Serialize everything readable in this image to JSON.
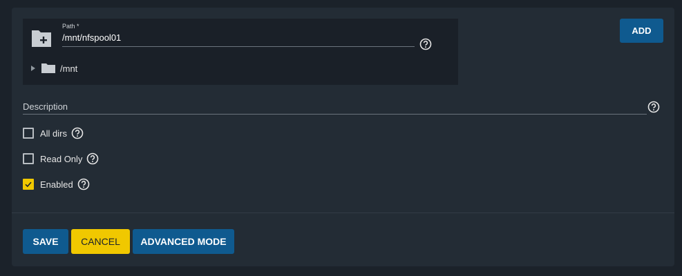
{
  "path_field": {
    "label": "Path *",
    "value": "/mnt/nfspool01",
    "tree_root": "/mnt"
  },
  "add_button": "ADD",
  "description": {
    "label": "Description"
  },
  "checkboxes": [
    {
      "label": "All dirs",
      "checked": false
    },
    {
      "label": "Read Only",
      "checked": false
    },
    {
      "label": "Enabled",
      "checked": true
    }
  ],
  "actions": {
    "save": "SAVE",
    "cancel": "CANCEL",
    "advanced": "ADVANCED MODE"
  },
  "colors": {
    "primary": "#0f5a8f",
    "accent": "#f0c800",
    "background": "#1b222a",
    "card": "#232c35"
  }
}
